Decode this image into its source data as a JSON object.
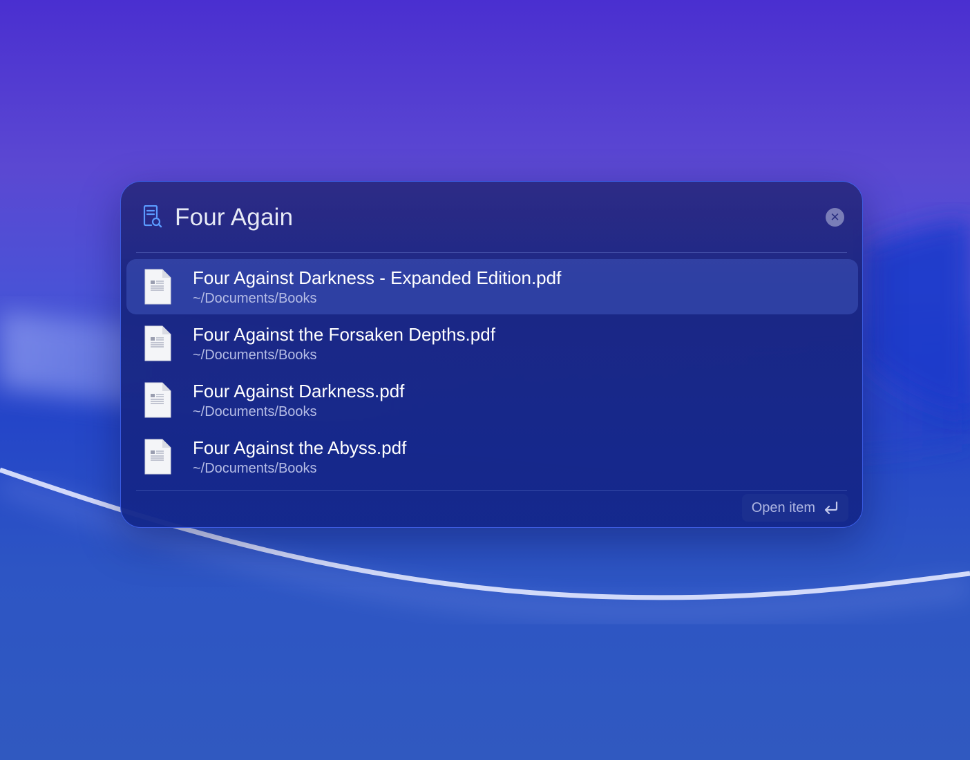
{
  "search": {
    "query": "Four Again",
    "clear_icon": "close-icon"
  },
  "results": [
    {
      "title": "Four Against Darkness - Expanded Edition.pdf",
      "path": "~/Documents/Books",
      "icon": "document-icon",
      "selected": true
    },
    {
      "title": "Four Against the Forsaken Depths.pdf",
      "path": "~/Documents/Books",
      "icon": "document-icon",
      "selected": false
    },
    {
      "title": "Four Against Darkness.pdf",
      "path": "~/Documents/Books",
      "icon": "document-icon",
      "selected": false
    },
    {
      "title": "Four Against the Abyss.pdf",
      "path": "~/Documents/Books",
      "icon": "document-icon",
      "selected": false
    }
  ],
  "footer": {
    "action_label": "Open item",
    "action_icon": "return-key-icon"
  },
  "colors": {
    "accent": "#4f8cff",
    "panel_border": "#4a6bff",
    "selection": "#465fc8"
  }
}
